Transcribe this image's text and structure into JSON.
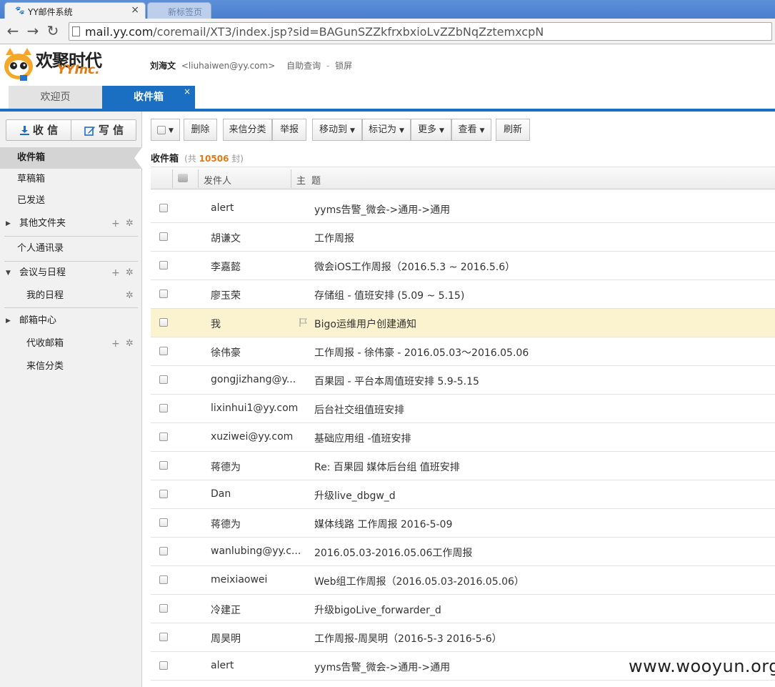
{
  "browser": {
    "tabs": [
      {
        "title": "YY邮件系统",
        "close": "×"
      },
      {
        "title": "新标签页"
      }
    ],
    "url_host": "mail.yy.com",
    "url_path": "/coremail/XT3/index.jsp?sid=BAGunSZZkfrxbxioLvZZbNqZztemxcpN"
  },
  "header": {
    "logo_cn": "欢聚时代",
    "logo_en": "YYInc.",
    "user_name": "刘海文",
    "user_email": "<liuhaiwen@yy.com>",
    "self_query": "自助查询",
    "separator": "-",
    "lock_screen": "锁屏"
  },
  "main_tabs": {
    "welcome": "欢迎页",
    "inbox": "收件箱",
    "close": "×"
  },
  "sidebar": {
    "receive": "收 信",
    "compose": "写 信",
    "items": [
      {
        "label": "收件箱"
      },
      {
        "label": "草稿箱"
      },
      {
        "label": "已发送"
      },
      {
        "label": "其他文件夹"
      },
      {
        "label": "个人通讯录"
      },
      {
        "label": "会议与日程"
      },
      {
        "label": "我的日程"
      },
      {
        "label": "邮箱中心"
      },
      {
        "label": "代收邮箱"
      },
      {
        "label": "来信分类"
      }
    ]
  },
  "toolbar": {
    "delete": "删除",
    "classify": "来信分类",
    "report": "举报",
    "move_to": "移动到",
    "mark_as": "标记为",
    "more": "更多",
    "view": "查看",
    "refresh": "刷新"
  },
  "list": {
    "title": "收件箱",
    "count_prefix": "(共",
    "count": "10506",
    "count_suffix": "封)",
    "col_sender": "发件人",
    "col_subject": "主题"
  },
  "messages": [
    {
      "from": "alert",
      "subject": "yyms告警_微会->通用->通用"
    },
    {
      "from": "胡谦文",
      "subject": "工作周报"
    },
    {
      "from": "李嘉懿",
      "subject": "微会iOS工作周报（2016.5.3 ~ 2016.5.6）"
    },
    {
      "from": "廖玉荣",
      "subject": "存储组 - 值班安排 (5.09 ~ 5.15)"
    },
    {
      "from": "我",
      "subject": "Bigo运维用户创建通知"
    },
    {
      "from": "徐伟豪",
      "subject": "工作周报 - 徐伟豪 - 2016.05.03～2016.05.06"
    },
    {
      "from": "gongjizhang@y...",
      "subject": "百果园 - 平台本周值班安排 5.9-5.15"
    },
    {
      "from": "lixinhui1@yy.com",
      "subject": "后台社交组值班安排"
    },
    {
      "from": "xuziwei@yy.com",
      "subject": "基础应用组 -值班安排"
    },
    {
      "from": "蒋德为",
      "subject": "Re: 百果园 媒体后台组 值班安排"
    },
    {
      "from": "Dan",
      "subject": "升级live_dbgw_d"
    },
    {
      "from": "蒋德为",
      "subject": "媒体线路 工作周报 2016-5-09"
    },
    {
      "from": "wanlubing@yy.c...",
      "subject": "2016.05.03-2016.05.06工作周报"
    },
    {
      "from": "meixiaowei",
      "subject": "Web组工作周报（2016.05.03-2016.05.06）"
    },
    {
      "from": "冷建正",
      "subject": "升级bigoLive_forwarder_d"
    },
    {
      "from": "周昊明",
      "subject": "工作周报-周昊明（2016-5-3 2016-5-6）"
    },
    {
      "from": "alert",
      "subject": "yyms告警_微会->通用->通用"
    }
  ],
  "watermark": "www.wooyun.org",
  "colors": {
    "accent": "#1a6fc2",
    "highlight_row": "#fbf3cf",
    "count": "#e07a16"
  }
}
